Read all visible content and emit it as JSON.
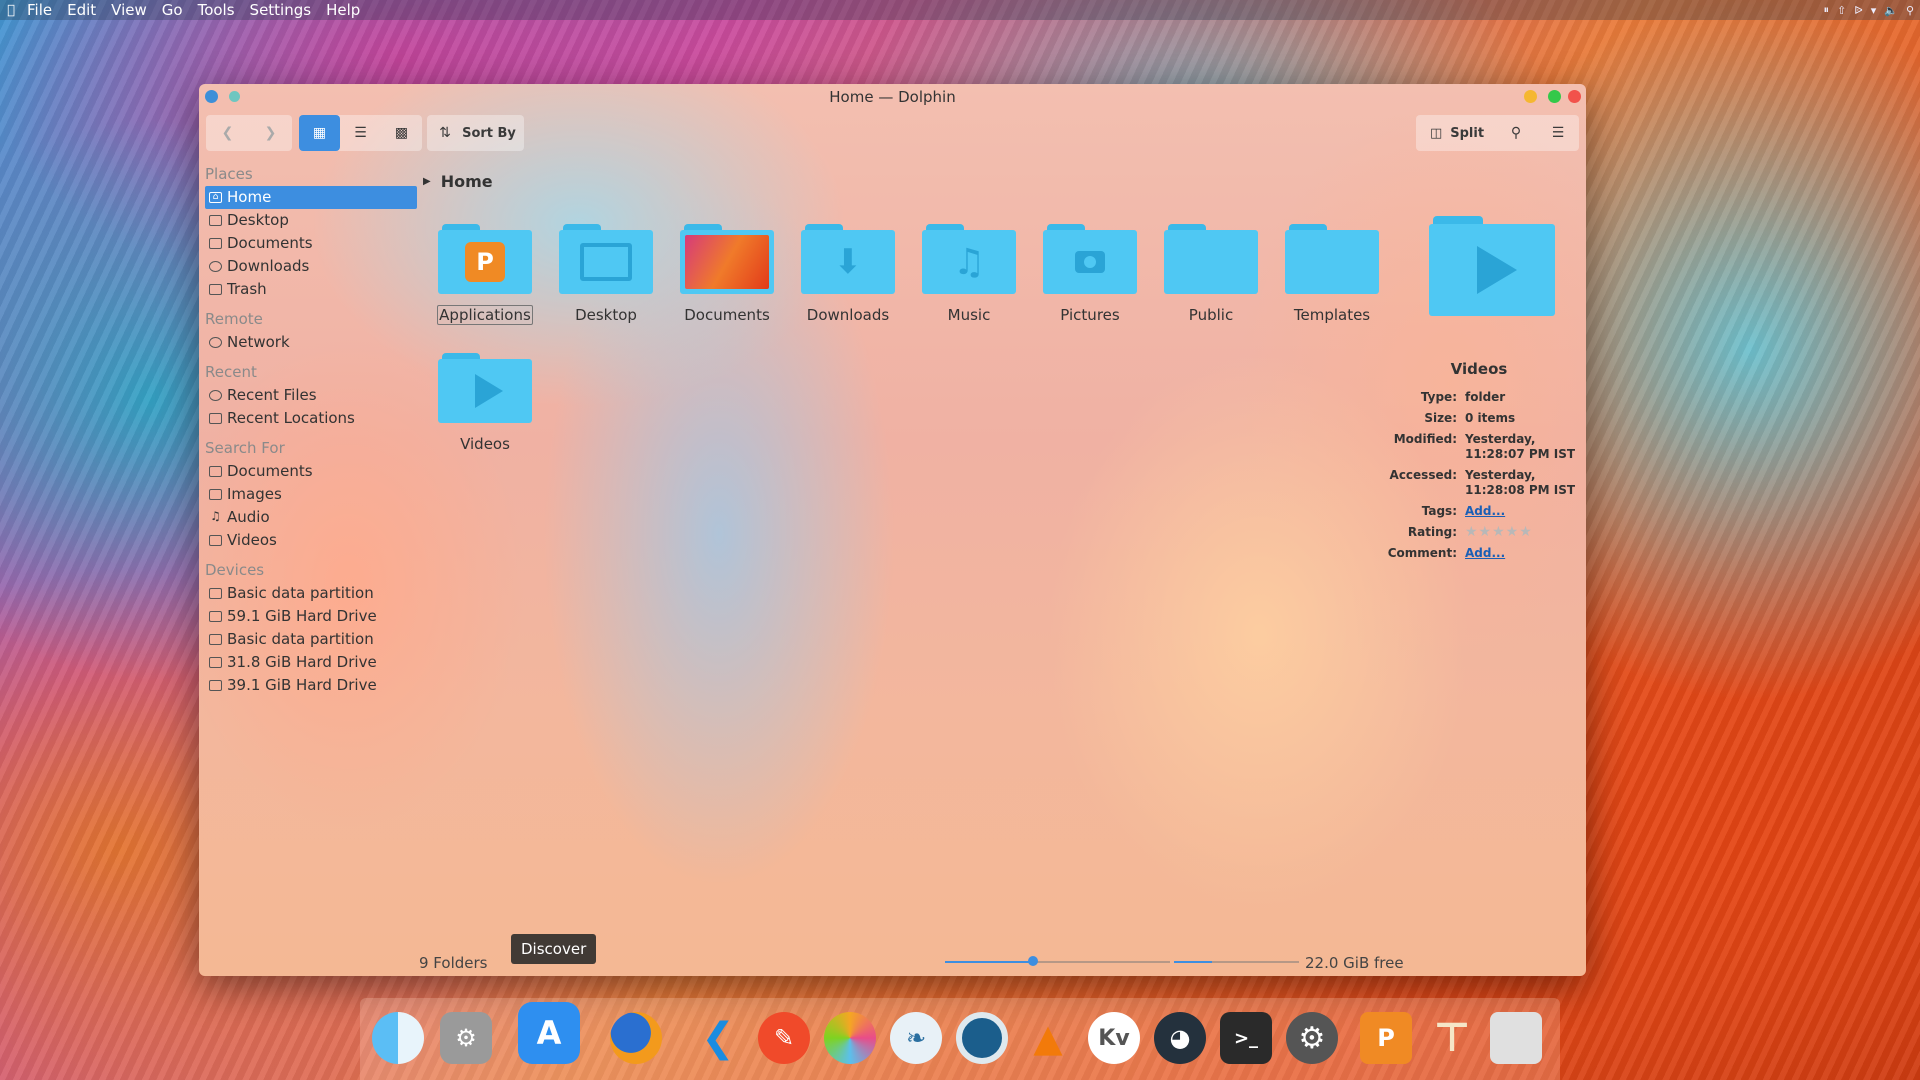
{
  "menubar": {
    "items": [
      "File",
      "Edit",
      "View",
      "Go",
      "Tools",
      "Settings",
      "Help"
    ]
  },
  "window": {
    "title": "Home — Dolphin"
  },
  "toolbar": {
    "sort_label": "Sort By",
    "split_label": "Split"
  },
  "sidebar": {
    "sections": [
      {
        "title": "Places",
        "items": [
          "Home",
          "Desktop",
          "Documents",
          "Downloads",
          "Trash"
        ]
      },
      {
        "title": "Remote",
        "items": [
          "Network"
        ]
      },
      {
        "title": "Recent",
        "items": [
          "Recent Files",
          "Recent Locations"
        ]
      },
      {
        "title": "Search For",
        "items": [
          "Documents",
          "Images",
          "Audio",
          "Videos"
        ]
      },
      {
        "title": "Devices",
        "items": [
          "Basic data partition",
          "59.1 GiB Hard Drive",
          "Basic data partition",
          "31.8 GiB Hard Drive",
          "39.1 GiB Hard Drive"
        ]
      }
    ]
  },
  "breadcrumb": "Home",
  "folders": [
    "Applications",
    "Desktop",
    "Documents",
    "Downloads",
    "Music",
    "Pictures",
    "Public",
    "Templates",
    "Videos"
  ],
  "info": {
    "title": "Videos",
    "rows": [
      {
        "key": "Type:",
        "value": "folder"
      },
      {
        "key": "Size:",
        "value": "0 items"
      },
      {
        "key": "Modified:",
        "value": "Yesterday, 11:28:07 PM IST"
      },
      {
        "key": "Accessed:",
        "value": "Yesterday, 11:28:08 PM IST"
      },
      {
        "key": "Tags:",
        "value": "Add..."
      },
      {
        "key": "Rating:",
        "value": "★★★★★"
      },
      {
        "key": "Comment:",
        "value": "Add..."
      }
    ]
  },
  "status": {
    "count": "9 Folders",
    "free": "22.0 GiB free",
    "zoom_fraction": 0.39,
    "space_used_fraction": 0.3
  },
  "tooltip": "Discover",
  "dock": {
    "apps": [
      "finder",
      "launchpad",
      "discover",
      "firefox",
      "vscode",
      "text-editor",
      "photos",
      "calligra",
      "music-player",
      "vlc",
      "kvantum",
      "system-monitor",
      "terminal",
      "system-settings",
      "store",
      "pin",
      "trash"
    ]
  },
  "colors": {
    "accent": "#3d8ee0",
    "folder": "#4fc8f3"
  }
}
